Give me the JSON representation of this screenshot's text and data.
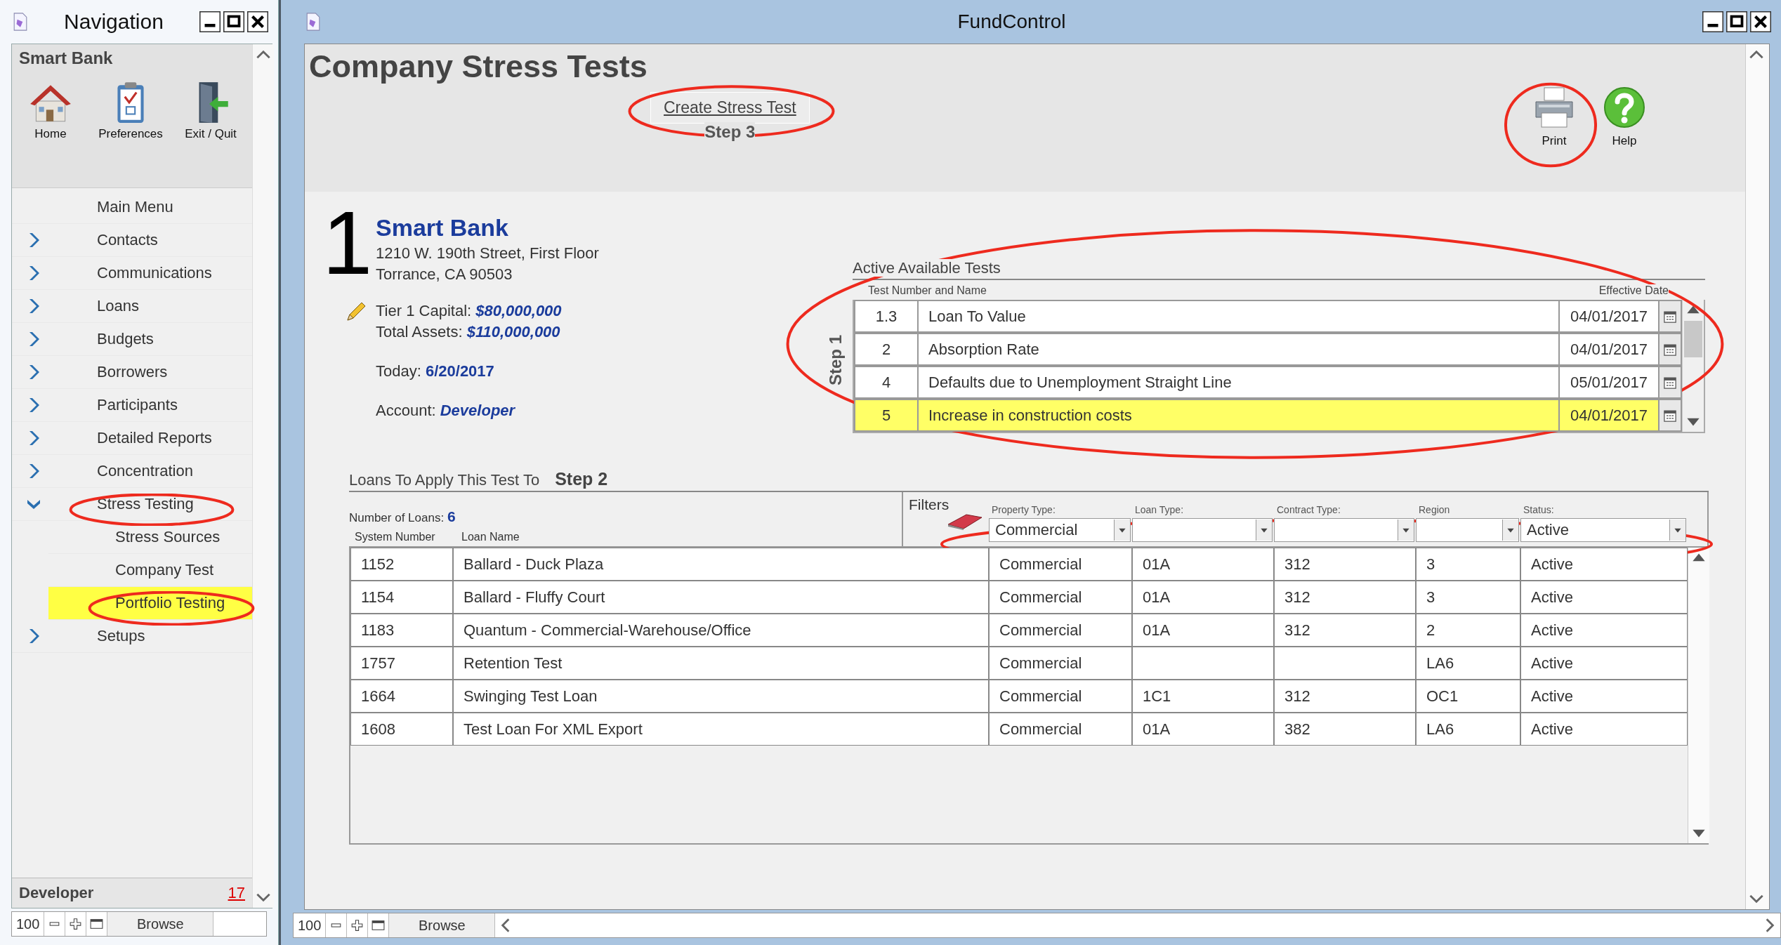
{
  "navigation": {
    "title": "Navigation",
    "header": "Smart Bank",
    "toolbar": [
      {
        "label": "Home",
        "kind": "home"
      },
      {
        "label": "Preferences",
        "kind": "preferences"
      },
      {
        "label": "Exit / Quit",
        "kind": "exit"
      }
    ],
    "items": [
      {
        "label": "Main Menu",
        "kind": "link",
        "selected": false
      },
      {
        "label": "Contacts",
        "kind": "group",
        "expanded": false,
        "selected": false
      },
      {
        "label": "Communications",
        "kind": "group",
        "expanded": false,
        "selected": false
      },
      {
        "label": "Loans",
        "kind": "group",
        "expanded": false,
        "selected": false
      },
      {
        "label": "Budgets",
        "kind": "group",
        "expanded": false,
        "selected": false
      },
      {
        "label": "Borrowers",
        "kind": "group",
        "expanded": false,
        "selected": false
      },
      {
        "label": "Participants",
        "kind": "group",
        "expanded": false,
        "selected": false
      },
      {
        "label": "Detailed Reports",
        "kind": "group",
        "expanded": false,
        "selected": false
      },
      {
        "label": "Concentration",
        "kind": "group",
        "expanded": false,
        "selected": false
      },
      {
        "label": "Stress Testing",
        "kind": "group",
        "expanded": true,
        "selected": false,
        "children": [
          {
            "label": "Stress Sources",
            "kind": "link",
            "selected": false
          },
          {
            "label": "Company Test",
            "kind": "link",
            "selected": false
          },
          {
            "label": "Portfolio Testing",
            "kind": "link",
            "selected": true
          }
        ]
      },
      {
        "label": "Setups",
        "kind": "group",
        "expanded": false,
        "selected": false
      }
    ],
    "footer": {
      "account": "Developer",
      "count": "17"
    },
    "status_bar": {
      "zoom": "100",
      "mode": "Browse"
    }
  },
  "window": {
    "title": "FundControl"
  },
  "page_title": "Company Stress Tests",
  "create_button": "Create Stress Test",
  "step_3": "Step 3",
  "toolbar": [
    {
      "label": "Print",
      "kind": "print"
    },
    {
      "label": "Help",
      "kind": "help"
    }
  ],
  "company": {
    "number": "1",
    "name": "Smart Bank",
    "address_lines": [
      "1210 W. 190th Street, First Floor",
      "Torrance, CA  90503"
    ],
    "tier1_label": "Tier 1 Capital:",
    "tier1_value": "$80,000,000",
    "assets_label": "Total Assets:",
    "assets_value": "$110,000,000",
    "today_label": "Today:",
    "today_value": "6/20/2017",
    "account_label": "Account:",
    "account_value": "Developer"
  },
  "tests": {
    "title": "Active Available Tests",
    "step": "Step 1",
    "columns": [
      "Test Number and Name",
      "Effective Date"
    ],
    "rows": [
      {
        "number": "1.3",
        "name": "Loan To Value",
        "date": "04/01/2017",
        "selected": false
      },
      {
        "number": "2",
        "name": "Absorption Rate",
        "date": "04/01/2017",
        "selected": false
      },
      {
        "number": "4",
        "name": "Defaults due to Unemployment Straight Line",
        "date": "05/01/2017",
        "selected": false
      },
      {
        "number": "5",
        "name": "Increase in construction costs",
        "date": "04/01/2017",
        "selected": true
      }
    ]
  },
  "loans": {
    "title": "Loans To Apply This Test To",
    "step": "Step 2",
    "count_label": "Number of Loans:",
    "count": "6",
    "columns": [
      "System Number",
      "Loan Name"
    ],
    "filters_label": "Filters",
    "filters": [
      {
        "label": "Property Type:",
        "value": "Commercial"
      },
      {
        "label": "Loan Type:"
      },
      {
        "label": "Contract Type:"
      },
      {
        "label": "Region"
      },
      {
        "label": "Status:",
        "value": "Active"
      }
    ],
    "rows": [
      {
        "number": "1152",
        "name": "Ballard - Duck Plaza",
        "property_type": "Commercial",
        "loan_type": "01A",
        "contract_type": "312",
        "region": "3",
        "status": "Active"
      },
      {
        "number": "1154",
        "name": "Ballard - Fluffy Court",
        "property_type": "Commercial",
        "loan_type": "01A",
        "contract_type": "312",
        "region": "3",
        "status": "Active"
      },
      {
        "number": "1183",
        "name": "Quantum - Commercial-Warehouse/Office",
        "property_type": "Commercial",
        "loan_type": "01A",
        "contract_type": "312",
        "region": "2",
        "status": "Active"
      },
      {
        "number": "1757",
        "name": "Retention Test",
        "property_type": "Commercial",
        "region": "LA6",
        "status": "Active"
      },
      {
        "number": "1664",
        "name": "Swinging Test Loan",
        "property_type": "Commercial",
        "loan_type": "1C1",
        "contract_type": "312",
        "region": "OC1",
        "status": "Active"
      },
      {
        "number": "1608",
        "name": "Test Loan For XML Export",
        "property_type": "Commercial",
        "loan_type": "01A",
        "contract_type": "382",
        "region": "LA6",
        "status": "Active"
      }
    ]
  },
  "main_status_bar": {
    "zoom": "100",
    "mode": "Browse"
  }
}
